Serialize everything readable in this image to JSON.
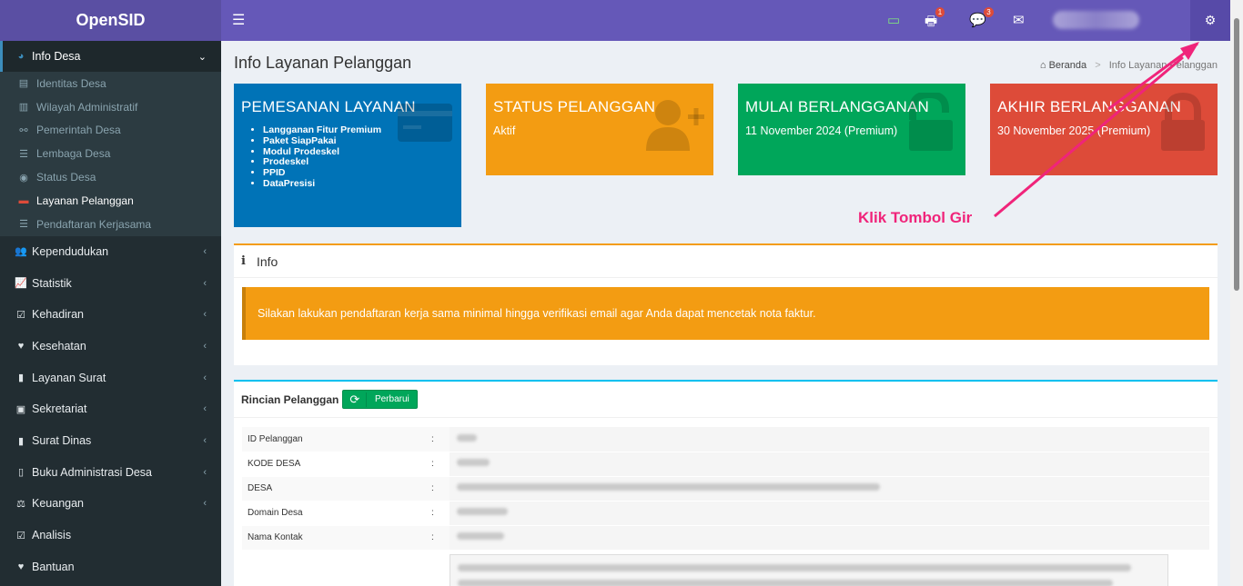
{
  "app": {
    "brand": "OpenSID"
  },
  "sidebar": {
    "open_menu": {
      "label": "Info Desa"
    },
    "submenu": [
      {
        "label": "Identitas Desa",
        "icon": "id-card-icon"
      },
      {
        "label": "Wilayah Administratif",
        "icon": "map-icon"
      },
      {
        "label": "Pemerintah Desa",
        "icon": "sitemap-icon"
      },
      {
        "label": "Lembaga Desa",
        "icon": "list-icon"
      },
      {
        "label": "Status Desa",
        "icon": "circle-icon"
      },
      {
        "label": "Layanan Pelanggan",
        "icon": "credit-card-icon",
        "active": true
      },
      {
        "label": "Pendaftaran Kerjasama",
        "icon": "list-icon"
      }
    ],
    "menu": [
      {
        "label": "Kependudukan",
        "icon": "users-icon"
      },
      {
        "label": "Statistik",
        "icon": "line-chart-icon"
      },
      {
        "label": "Kehadiran",
        "icon": "calendar-check-icon"
      },
      {
        "label": "Kesehatan",
        "icon": "heartbeat-icon"
      },
      {
        "label": "Layanan Surat",
        "icon": "book-icon"
      },
      {
        "label": "Sekretariat",
        "icon": "archive-icon"
      },
      {
        "label": "Surat Dinas",
        "icon": "book-icon"
      },
      {
        "label": "Buku Administrasi Desa",
        "icon": "books-icon"
      },
      {
        "label": "Keuangan",
        "icon": "balance-scale-icon"
      },
      {
        "label": "Analisis",
        "icon": "check-square-icon"
      },
      {
        "label": "Bantuan",
        "icon": "heart-icon"
      }
    ]
  },
  "navbar": {
    "print_badge": "1",
    "comment_badge": "3"
  },
  "page": {
    "title": "Info Layanan Pelanggan",
    "breadcrumb_home": "Beranda",
    "breadcrumb_current": "Info Layanan Pelanggan"
  },
  "cards": {
    "pemesanan": {
      "title": "PEMESANAN LAYANAN",
      "items": [
        "Langganan Fitur Premium",
        "Paket SiapPakai",
        "Modul Prodeskel",
        "Prodeskel",
        "PPID",
        "DataPresisi"
      ]
    },
    "status": {
      "title": "STATUS PELANGGAN",
      "value": "Aktif"
    },
    "mulai": {
      "title": "MULAI BERLANGGANAN",
      "value": "11 November 2024 (Premium)"
    },
    "akhir": {
      "title": "AKHIR BERLANGGANAN",
      "value": "30 November 2025 (Premium)"
    }
  },
  "info": {
    "title": "Info",
    "alert": "Silakan lakukan pendaftaran kerja sama minimal hingga verifikasi email agar Anda dapat mencetak nota faktur."
  },
  "details": {
    "title": "Rincian Pelanggan",
    "update_button": "Perbarui",
    "rows": [
      {
        "label": "ID Pelanggan"
      },
      {
        "label": "KODE DESA"
      },
      {
        "label": "DESA"
      },
      {
        "label": "Domain Desa"
      },
      {
        "label": "Nama Kontak"
      }
    ],
    "separator": ":"
  },
  "annotation": {
    "text": "Klik Tombol Gir",
    "color": "#f0247a"
  }
}
